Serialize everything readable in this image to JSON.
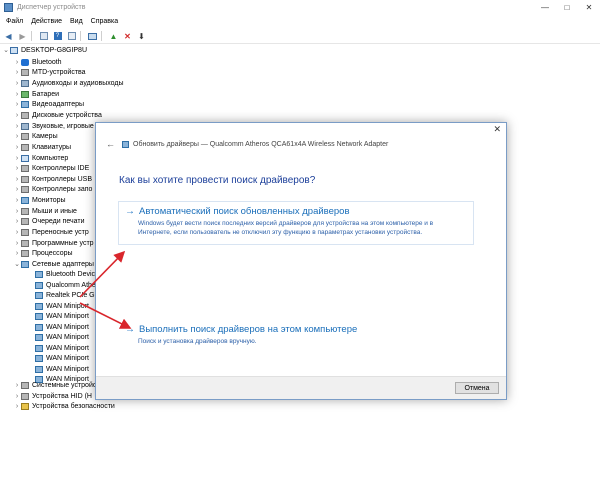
{
  "window": {
    "title": "Диспетчер устройств",
    "controls": [
      "—",
      "□",
      "✕"
    ]
  },
  "menu": [
    "Файл",
    "Действие",
    "Вид",
    "Справка"
  ],
  "toolbar": {
    "buttons": [
      "back-icon",
      "forward-icon",
      "properties-icon",
      "help-icon",
      "update-driver-icon",
      "scan-icon",
      "enable-icon",
      "uninstall-icon",
      "download-icon"
    ]
  },
  "tree": {
    "root": "DESKTOP-G8GIP8U",
    "items": [
      "Bluetooth",
      "MTD-устройства",
      "Аудиовходы и аудиовыходы",
      "Батареи",
      "Видеоадаптеры",
      "Дисковые устройства",
      "Звуковые, игровые и",
      "Камеры",
      "Клавиатуры",
      "Компьютер",
      "Контроллеры IDE",
      "Контроллеры USB",
      "Контроллеры запо",
      "Мониторы",
      "Мыши и иные",
      "Очереди печати",
      "Переносные устр",
      "Программные устр",
      "Процессоры",
      "Сетевые адаптеры"
    ],
    "network_children": [
      "Bluetooth Devic",
      "Qualcomm Athe",
      "Realtek PCIe GB",
      "WAN Miniport",
      "WAN Miniport",
      "WAN Miniport",
      "WAN Miniport",
      "WAN Miniport",
      "WAN Miniport",
      "WAN Miniport",
      "WAN Miniport"
    ],
    "after_items": [
      "Системные устройства",
      "Устройства HID (H",
      "Устройства безопасности"
    ]
  },
  "dialog": {
    "header": "Обновить драйверы — Qualcomm Atheros QCA61x4A Wireless Network Adapter",
    "question": "Как вы хотите провести поиск драйверов?",
    "option1": {
      "title": "Автоматический поиск обновленных драйверов",
      "desc": "Windows будет вести поиск последних версий драйверов для устройства на этом компьютере и в Интернете, если пользователь не отключил эту функцию в параметрах установки устройства."
    },
    "option2": {
      "title": "Выполнить поиск драйверов на этом компьютере",
      "desc": "Поиск и установка драйверов вручную."
    },
    "cancel": "Отмена"
  },
  "colors": {
    "arrow": "#d9262c",
    "link": "#1b6fba",
    "question": "#1c3f9a"
  }
}
